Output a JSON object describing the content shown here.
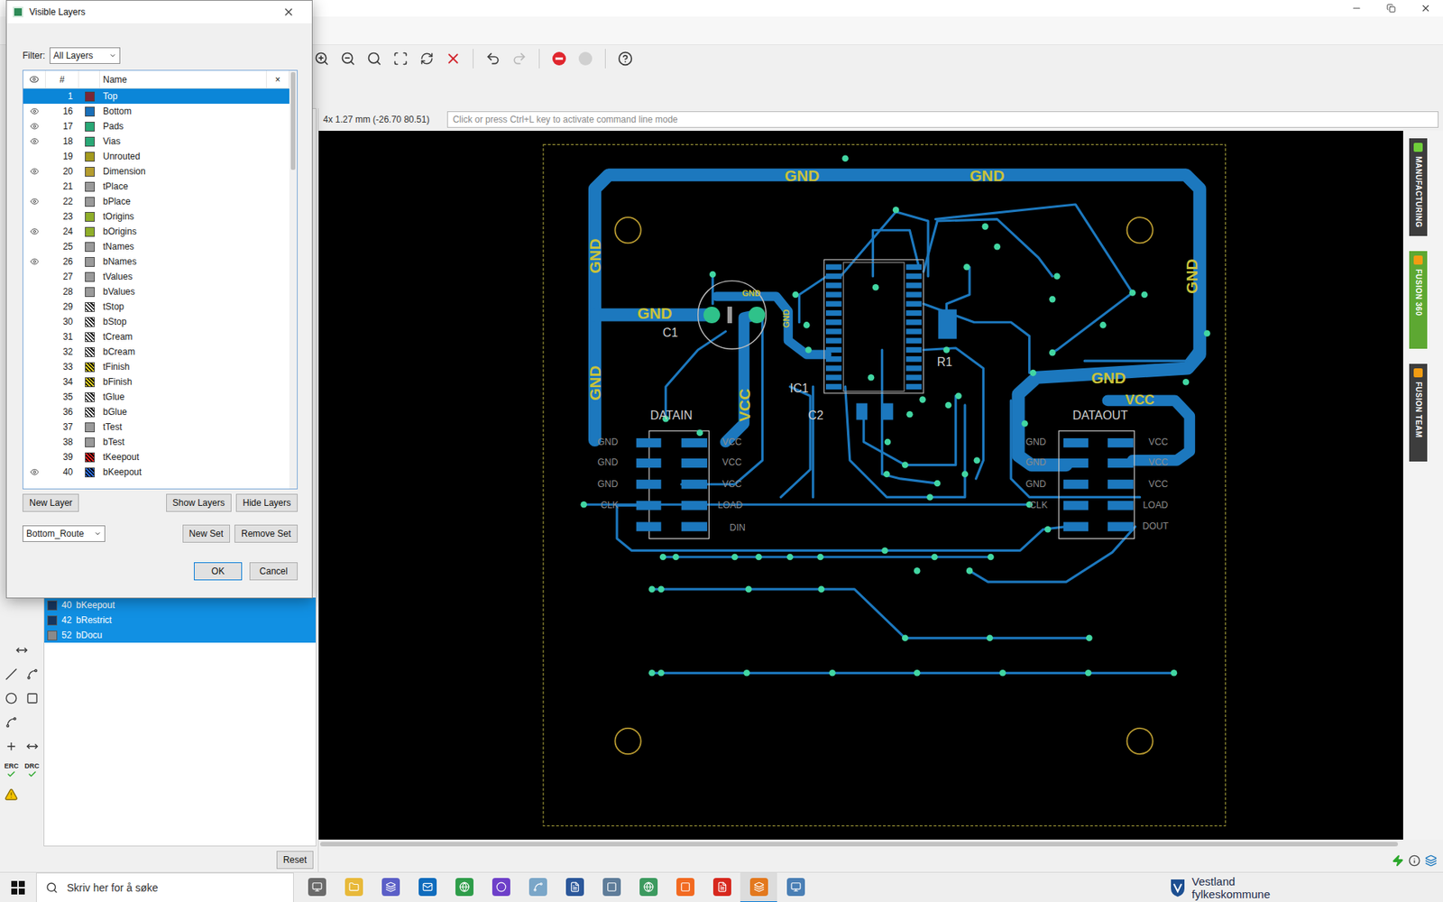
{
  "dialog": {
    "title": "Visible Layers",
    "filter_label": "Filter:",
    "filter_value": "All Layers",
    "columns": {
      "number": "#",
      "name": "Name",
      "clear": "×"
    },
    "layers": [
      {
        "number": "1",
        "name": "Top",
        "visible": false,
        "selected": true,
        "color": "#7a2636",
        "kind": "solid"
      },
      {
        "number": "16",
        "name": "Bottom",
        "visible": true,
        "selected": false,
        "color": "#1a6fb8",
        "kind": "solid"
      },
      {
        "number": "17",
        "name": "Pads",
        "visible": true,
        "selected": false,
        "color": "#2aa876",
        "kind": "solid"
      },
      {
        "number": "18",
        "name": "Vias",
        "visible": true,
        "selected": false,
        "color": "#2aa876",
        "kind": "solid"
      },
      {
        "number": "19",
        "name": "Unrouted",
        "visible": false,
        "selected": false,
        "color": "#a39a1e",
        "kind": "solid"
      },
      {
        "number": "20",
        "name": "Dimension",
        "visible": true,
        "selected": false,
        "color": "#b59d2f",
        "kind": "solid"
      },
      {
        "number": "21",
        "name": "tPlace",
        "visible": false,
        "selected": false,
        "color": "#9a9a9a",
        "kind": "solid"
      },
      {
        "number": "22",
        "name": "bPlace",
        "visible": true,
        "selected": false,
        "color": "#9a9a9a",
        "kind": "solid"
      },
      {
        "number": "23",
        "name": "tOrigins",
        "visible": false,
        "selected": false,
        "color": "#8fae2a",
        "kind": "solid"
      },
      {
        "number": "24",
        "name": "bOrigins",
        "visible": true,
        "selected": false,
        "color": "#8fae2a",
        "kind": "solid"
      },
      {
        "number": "25",
        "name": "tNames",
        "visible": false,
        "selected": false,
        "color": "#9a9a9a",
        "kind": "solid"
      },
      {
        "number": "26",
        "name": "bNames",
        "visible": true,
        "selected": false,
        "color": "#9a9a9a",
        "kind": "solid"
      },
      {
        "number": "27",
        "name": "tValues",
        "visible": false,
        "selected": false,
        "color": "#9a9a9a",
        "kind": "solid"
      },
      {
        "number": "28",
        "name": "bValues",
        "visible": false,
        "selected": false,
        "color": "#9a9a9a",
        "kind": "solid"
      },
      {
        "number": "29",
        "name": "tStop",
        "visible": false,
        "selected": false,
        "color": "#ffffff",
        "kind": "hatch"
      },
      {
        "number": "30",
        "name": "bStop",
        "visible": false,
        "selected": false,
        "color": "#ffffff",
        "kind": "hatch"
      },
      {
        "number": "31",
        "name": "tCream",
        "visible": false,
        "selected": false,
        "color": "#ffffff",
        "kind": "hatch"
      },
      {
        "number": "32",
        "name": "bCream",
        "visible": false,
        "selected": false,
        "color": "#ffffff",
        "kind": "hatch"
      },
      {
        "number": "33",
        "name": "tFinish",
        "visible": false,
        "selected": false,
        "color": "#d8c820",
        "kind": "hatch"
      },
      {
        "number": "34",
        "name": "bFinish",
        "visible": false,
        "selected": false,
        "color": "#d8c820",
        "kind": "hatch"
      },
      {
        "number": "35",
        "name": "tGlue",
        "visible": false,
        "selected": false,
        "color": "#ffffff",
        "kind": "hatch"
      },
      {
        "number": "36",
        "name": "bGlue",
        "visible": false,
        "selected": false,
        "color": "#ffffff",
        "kind": "hatch"
      },
      {
        "number": "37",
        "name": "tTest",
        "visible": false,
        "selected": false,
        "color": "#9a9a9a",
        "kind": "solid"
      },
      {
        "number": "38",
        "name": "bTest",
        "visible": false,
        "selected": false,
        "color": "#9a9a9a",
        "kind": "solid"
      },
      {
        "number": "39",
        "name": "tKeepout",
        "visible": false,
        "selected": false,
        "color": "#e02020",
        "kind": "hatch"
      },
      {
        "number": "40",
        "name": "bKeepout",
        "visible": true,
        "selected": false,
        "color": "#2a6ad8",
        "kind": "hatch"
      }
    ],
    "buttons": {
      "new_layer": "New Layer",
      "show_layers": "Show Layers",
      "hide_layers": "Hide Layers",
      "new_set": "New Set",
      "remove_set": "Remove Set",
      "ok": "OK",
      "cancel": "Cancel"
    },
    "layer_set": "Bottom_Route"
  },
  "coordinates": "4x 1.27 mm (-26.70 80.51)",
  "command_placeholder": "Click or press Ctrl+L key to activate command line mode",
  "side_tabs": [
    {
      "label": "MANUFACTURING",
      "color": "#3d3d3d"
    },
    {
      "label": "FUSION 360",
      "color": "#5da832"
    },
    {
      "label": "FUSION TEAM",
      "color": "#3d3d3d"
    }
  ],
  "layer_panel": {
    "rows": [
      {
        "number": "40",
        "name": "bKeepout",
        "color": "#17365e",
        "selected": true
      },
      {
        "number": "42",
        "name": "bRestrict",
        "color": "#17365e",
        "selected": true
      },
      {
        "number": "52",
        "name": "bDocu",
        "color": "#8a8a8a",
        "selected": true
      }
    ],
    "reset": "Reset"
  },
  "tools": {
    "erc": "ERC",
    "drc": "DRC"
  },
  "pcb": {
    "labels": [
      {
        "text": "GND",
        "kind": "copper"
      },
      {
        "text": "GND",
        "kind": "copper"
      },
      {
        "text": "GND",
        "kind": "copper"
      },
      {
        "text": "GND",
        "kind": "copper"
      },
      {
        "text": "GND",
        "kind": "copper"
      },
      {
        "text": "GND",
        "kind": "copper"
      },
      {
        "text": "VCC",
        "kind": "copper"
      },
      {
        "text": "GND",
        "kind": "copper"
      },
      {
        "text": "VCC",
        "kind": "copper"
      },
      {
        "text": "GND",
        "kind": "copper"
      },
      {
        "text": "GND",
        "kind": "copper"
      },
      {
        "text": "C1",
        "kind": "silk"
      },
      {
        "text": "IC1",
        "kind": "silk"
      },
      {
        "text": "C2",
        "kind": "silk"
      },
      {
        "text": "R1",
        "kind": "silk"
      },
      {
        "text": "DATAIN",
        "kind": "silk"
      },
      {
        "text": "DATAOUT",
        "kind": "silk"
      },
      {
        "text": "GND",
        "kind": "pin"
      },
      {
        "text": "GND",
        "kind": "pin"
      },
      {
        "text": "GND",
        "kind": "pin"
      },
      {
        "text": "CLK",
        "kind": "pin"
      },
      {
        "text": "VCC",
        "kind": "pin"
      },
      {
        "text": "VCC",
        "kind": "pin"
      },
      {
        "text": "VCC",
        "kind": "pin"
      },
      {
        "text": "LOAD",
        "kind": "pin"
      },
      {
        "text": "DIN",
        "kind": "pin"
      },
      {
        "text": "GND",
        "kind": "pin"
      },
      {
        "text": "GND",
        "kind": "pin"
      },
      {
        "text": "GND",
        "kind": "pin"
      },
      {
        "text": "CLK",
        "kind": "pin"
      },
      {
        "text": "VCC",
        "kind": "pin"
      },
      {
        "text": "VCC",
        "kind": "pin"
      },
      {
        "text": "VCC",
        "kind": "pin"
      },
      {
        "text": "LOAD",
        "kind": "pin"
      },
      {
        "text": "DOUT",
        "kind": "pin"
      }
    ]
  },
  "taskbar": {
    "search_placeholder": "Skriv her for å søke",
    "org": [
      "Vestland",
      "fylkeskommune"
    ]
  }
}
